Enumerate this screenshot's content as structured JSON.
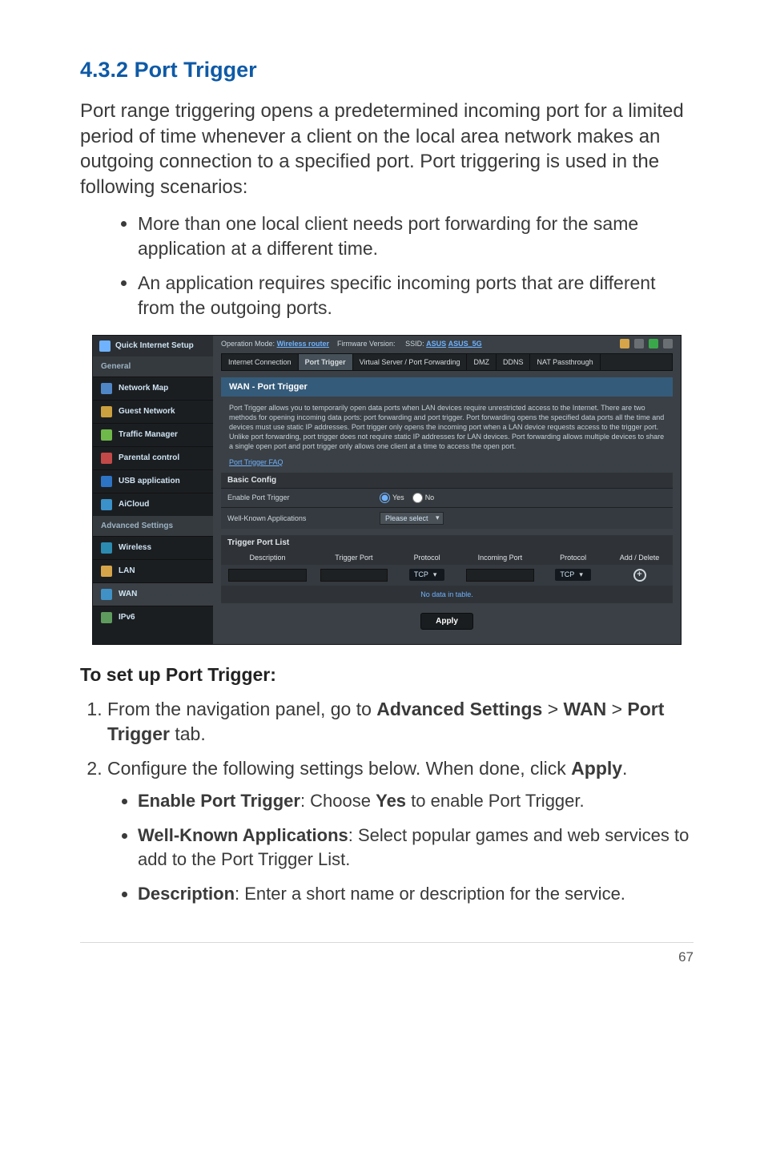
{
  "doc": {
    "heading_num": "4.3.2",
    "heading_title": "Port Trigger",
    "intro": "Port range triggering opens a predetermined incoming port for a limited period of time whenever a client on the local area network makes an outgoing connection to a specified port. Port triggering is used in the following scenarios:",
    "scenario1": "More than one local client needs port forwarding for the same application at a different time.",
    "scenario2": "An application requires specific incoming ports that are different from the outgoing ports.",
    "setup_heading": "To set up Port Trigger:",
    "step1_pre": "From the navigation panel, go to ",
    "step1_b1": "Advanced Settings",
    "step1_sep": " > ",
    "step1_b2": "WAN",
    "step1_sep2": " > ",
    "step1_b3": "Port Trigger",
    "step1_post": " tab.",
    "step2_pre": "Configure the following settings below. When done, click ",
    "step2_b1": "Apply",
    "step2_post": ".",
    "sub1_b": "Enable Port Trigger",
    "sub1_txt": ": Choose ",
    "sub1_b2": "Yes",
    "sub1_txt2": " to enable Port Trigger.",
    "sub2_b": "Well-Known Applications",
    "sub2_txt": ": Select popular games and web services to add to the Port Trigger List.",
    "sub3_b": "Description",
    "sub3_txt": ": Enter a short name or description for the service.",
    "page_number": "67"
  },
  "ui": {
    "sidebar": {
      "quick": "Quick Internet Setup",
      "group_general": "General",
      "items_general": [
        "Network Map",
        "Guest Network",
        "Traffic Manager",
        "Parental control",
        "USB application",
        "AiCloud"
      ],
      "group_adv": "Advanced Settings",
      "items_adv": [
        "Wireless",
        "LAN",
        "WAN",
        "IPv6"
      ]
    },
    "header": {
      "op_mode_label": "Operation Mode:",
      "op_mode_value": "Wireless router",
      "fw_label": "Firmware Version:",
      "ssid_label": "SSID:",
      "ssid1": "ASUS",
      "ssid2": "ASUS_5G"
    },
    "tabs": [
      "Internet Connection",
      "Port Trigger",
      "Virtual Server / Port Forwarding",
      "DMZ",
      "DDNS",
      "NAT Passthrough"
    ],
    "active_tab_index": 1,
    "panel_title": "WAN - Port Trigger",
    "explain": "Port Trigger allows you to temporarily open data ports when LAN devices require unrestricted access to the Internet. There are two methods for opening incoming data ports: port forwarding and port trigger. Port forwarding opens the specified data ports all the time and devices must use static IP addresses. Port trigger only opens the incoming port when a LAN device requests access to the trigger port. Unlike port forwarding, port trigger does not require static IP addresses for LAN devices. Port forwarding allows multiple devices to share a single open port and port trigger only allows one client at a time to access the open port.",
    "faq": "Port Trigger FAQ",
    "basic_config": "Basic Config",
    "row_enable": "Enable Port Trigger",
    "radio_yes": "Yes",
    "radio_no": "No",
    "row_wka": "Well-Known Applications",
    "wka_value": "Please select",
    "list_title": "Trigger Port List",
    "th": [
      "Description",
      "Trigger Port",
      "Protocol",
      "Incoming Port",
      "Protocol",
      "Add / Delete"
    ],
    "proto": "TCP",
    "nodata": "No data in table.",
    "apply": "Apply"
  }
}
